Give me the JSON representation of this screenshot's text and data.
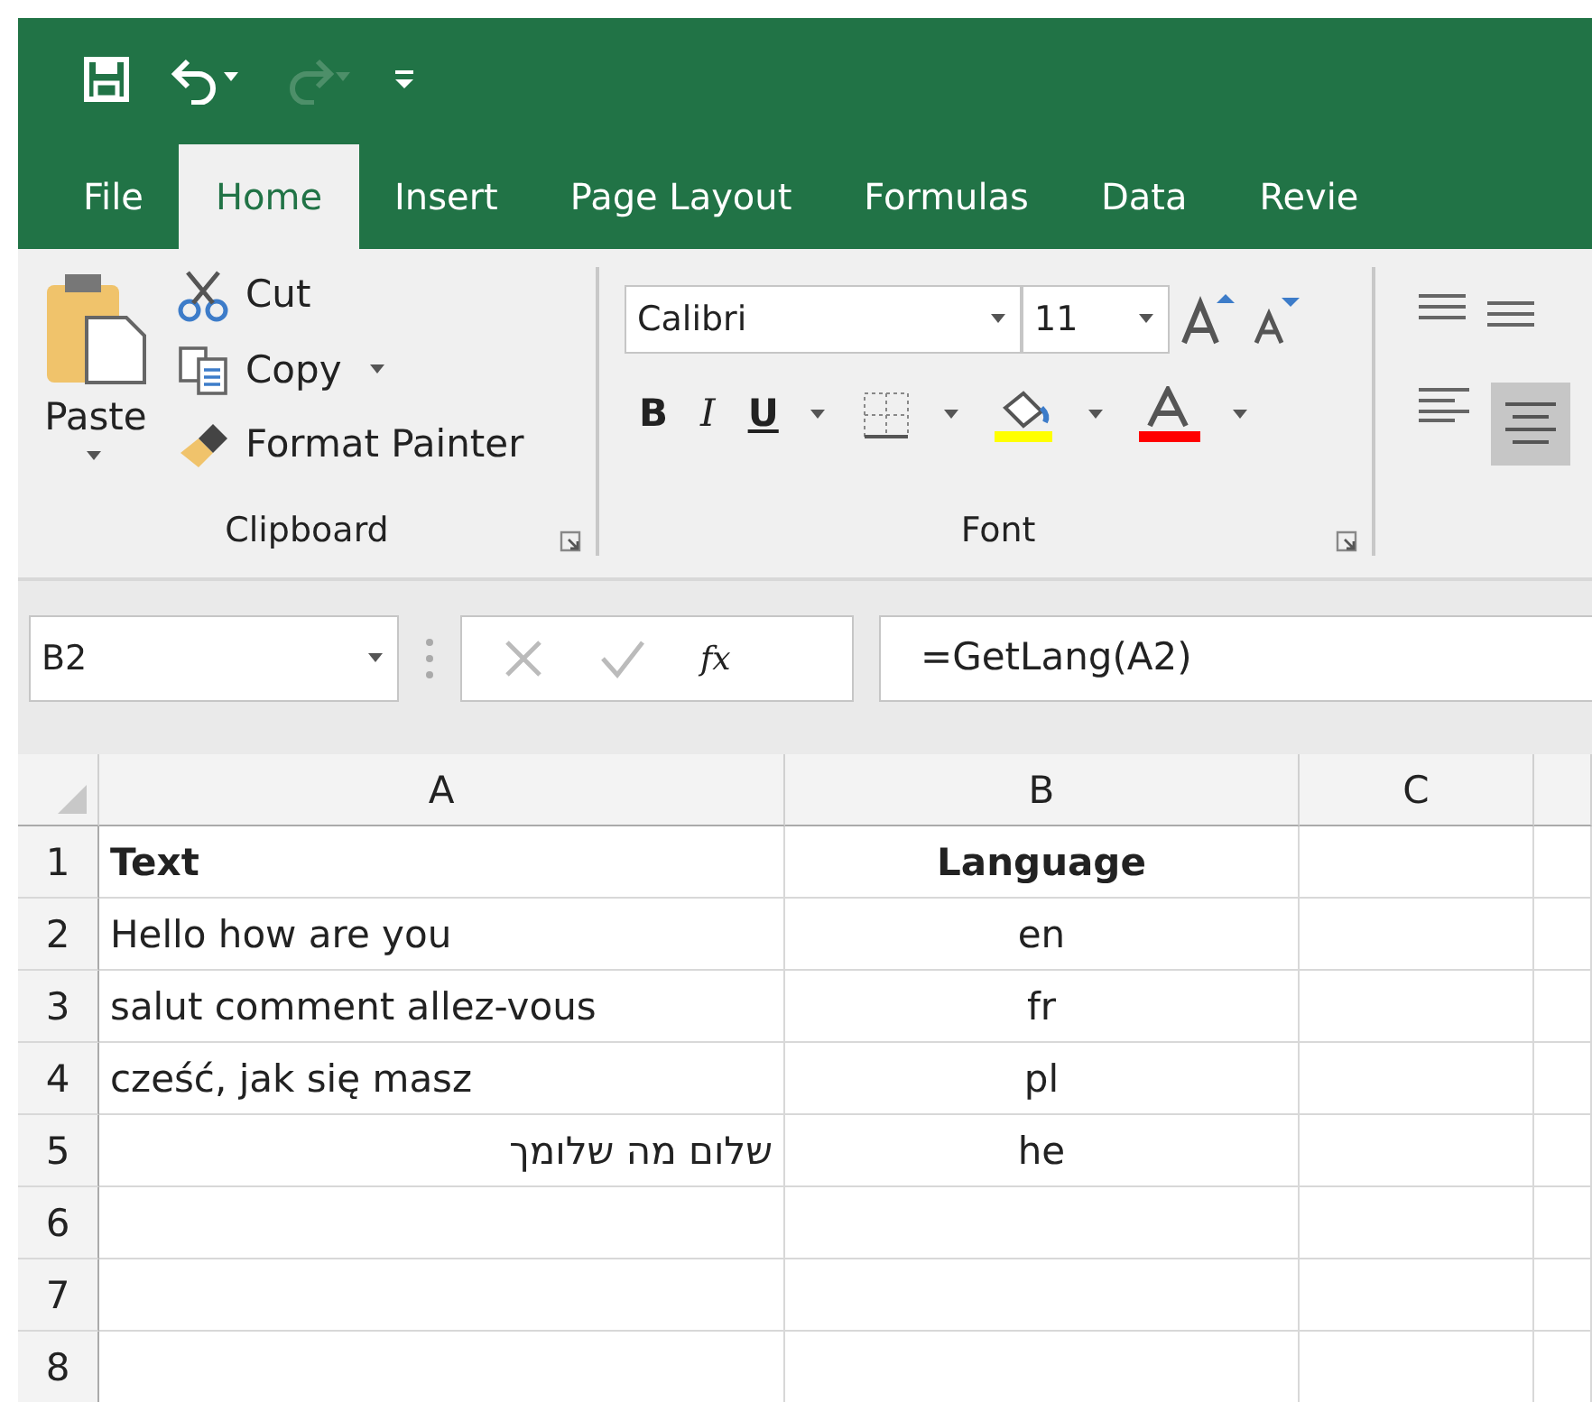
{
  "quick_access": [
    {
      "kind": "save",
      "disabled": false
    },
    {
      "kind": "undo",
      "disabled": false
    },
    {
      "kind": "redo",
      "disabled": true
    },
    {
      "kind": "customize",
      "disabled": false
    }
  ],
  "tabs": [
    {
      "label": "File",
      "selected": false
    },
    {
      "label": "Home",
      "selected": true
    },
    {
      "label": "Insert",
      "selected": false
    },
    {
      "label": "Page Layout",
      "selected": false
    },
    {
      "label": "Formulas",
      "selected": false
    },
    {
      "label": "Data",
      "selected": false
    },
    {
      "label": "Revie",
      "selected": false
    }
  ],
  "clipboard": {
    "paste": "Paste",
    "cut": "Cut",
    "copy": "Copy",
    "format_painter": "Format Painter",
    "label": "Clipboard"
  },
  "font": {
    "name": "Calibri",
    "size": "11",
    "bold": "B",
    "italic": "I",
    "underline": "U",
    "label": "Font"
  },
  "formula_bar": {
    "name_box": "B2",
    "fx": "fx",
    "formula": "=GetLang(A2)"
  },
  "sheet": {
    "columns": [
      "A",
      "B",
      "C"
    ],
    "header_row": {
      "number": "1",
      "cells": [
        "Text",
        "Language",
        ""
      ]
    },
    "rows": [
      {
        "number": "2",
        "cells": [
          "Hello how are you",
          "en",
          ""
        ]
      },
      {
        "number": "3",
        "cells": [
          "salut comment allez-vous",
          "fr",
          ""
        ]
      },
      {
        "number": "4",
        "cells": [
          "cześć, jak się masz",
          "pl",
          ""
        ]
      },
      {
        "number": "5",
        "cells": [
          "שלום מה שלומך",
          "he",
          ""
        ]
      },
      {
        "number": "6",
        "cells": [
          "",
          "",
          ""
        ]
      },
      {
        "number": "7",
        "cells": [
          "",
          "",
          ""
        ]
      },
      {
        "number": "8",
        "cells": [
          "",
          "",
          ""
        ]
      }
    ]
  }
}
